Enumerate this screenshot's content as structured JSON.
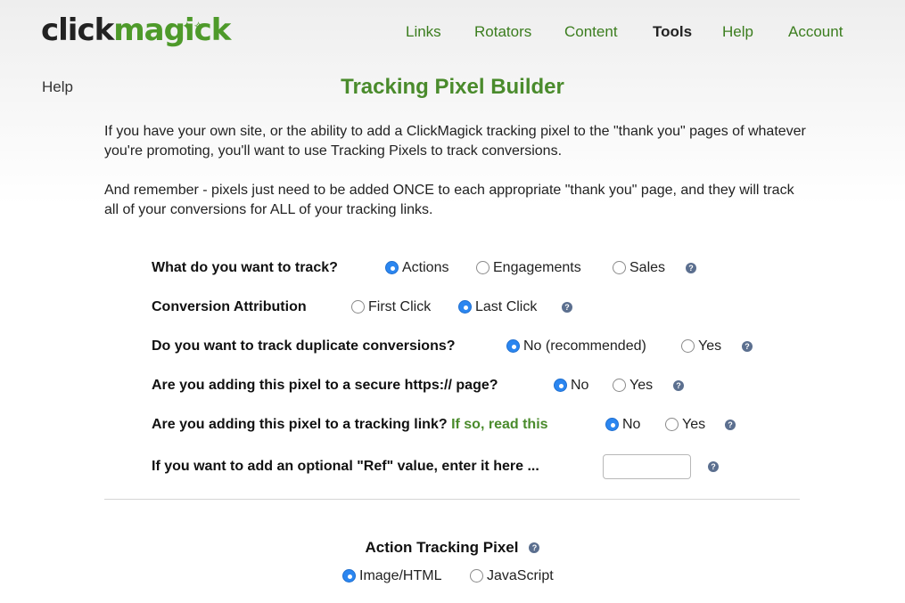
{
  "logo": {
    "part1": "click",
    "part2": "magick",
    "sparkle": "✦✧"
  },
  "nav": {
    "items": [
      {
        "label": "Links"
      },
      {
        "label": "Rotators"
      },
      {
        "label": "Content"
      },
      {
        "label": "Tools",
        "active": true
      },
      {
        "label": "Help"
      },
      {
        "label": "Account"
      }
    ]
  },
  "help_link": "Help",
  "page_title": "Tracking Pixel Builder",
  "intro": {
    "p1": "If you have your own site, or the ability to add a ClickMagick tracking pixel to the \"thank you\" pages of whatever you're promoting, you'll want to use Tracking Pixels to track conversions.",
    "p2": "And remember - pixels just need to be added ONCE to each appropriate \"thank you\" page, and they will track all of your conversions for ALL of your tracking links."
  },
  "questions": {
    "track": {
      "label": "What do you want to track?",
      "options": [
        "Actions",
        "Engagements",
        "Sales"
      ],
      "selected": "Actions"
    },
    "attribution": {
      "label": "Conversion Attribution",
      "options": [
        "First Click",
        "Last Click"
      ],
      "selected": "Last Click"
    },
    "duplicates": {
      "label": "Do you want to track duplicate conversions?",
      "options": [
        "No (recommended)",
        "Yes"
      ],
      "selected": "No (recommended)"
    },
    "secure": {
      "label": "Are you adding this pixel to a secure https:// page?",
      "options": [
        "No",
        "Yes"
      ],
      "selected": "No"
    },
    "tracking_link": {
      "label": "Are you adding this pixel to a tracking link?",
      "link_text": "If so, read this",
      "options": [
        "No",
        "Yes"
      ],
      "selected": "No"
    },
    "ref": {
      "label": "If you want to add an optional \"Ref\" value, enter it here ...",
      "value": ""
    }
  },
  "help_icon_glyph": "?",
  "action_pixel": {
    "title": "Action Tracking Pixel",
    "options": [
      "Image/HTML",
      "JavaScript"
    ],
    "selected": "Image/HTML"
  },
  "colors": {
    "accent_green": "#4a8b2c",
    "radio_blue": "#2b86f0"
  }
}
